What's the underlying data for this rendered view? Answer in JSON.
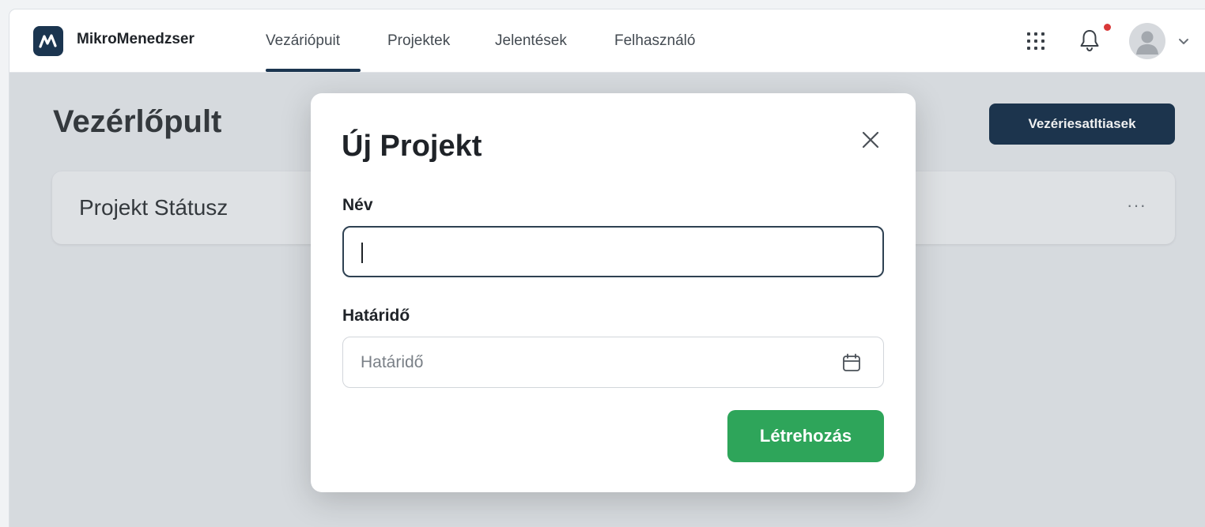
{
  "header": {
    "brand": "MikroMenedzser",
    "nav": [
      {
        "label": "Vezáriópuit",
        "active": true
      },
      {
        "label": "Projektek",
        "active": false
      },
      {
        "label": "Jelentések",
        "active": false
      },
      {
        "label": "Felhasználó",
        "active": false
      }
    ],
    "icons": [
      "apps-grid-icon",
      "bell-icon",
      "avatar-icon",
      "chevron-down-icon"
    ],
    "has_notification": true
  },
  "page": {
    "title": "Vezérlőpult",
    "primary_action_label": "Vezériesatltiasek",
    "status_card": {
      "title": "Projekt Státusz",
      "more": "···"
    }
  },
  "modal": {
    "title": "Új Projekt",
    "name_label": "Név",
    "name_value": "",
    "deadline_label": "Határidő",
    "deadline_placeholder": "Határidő",
    "submit_label": "Létrehozás"
  },
  "colors": {
    "brand_navy": "#1b3550",
    "primary_dark": "#0f2a45",
    "success_green": "#2ea55a",
    "notification_red": "#d93838"
  }
}
